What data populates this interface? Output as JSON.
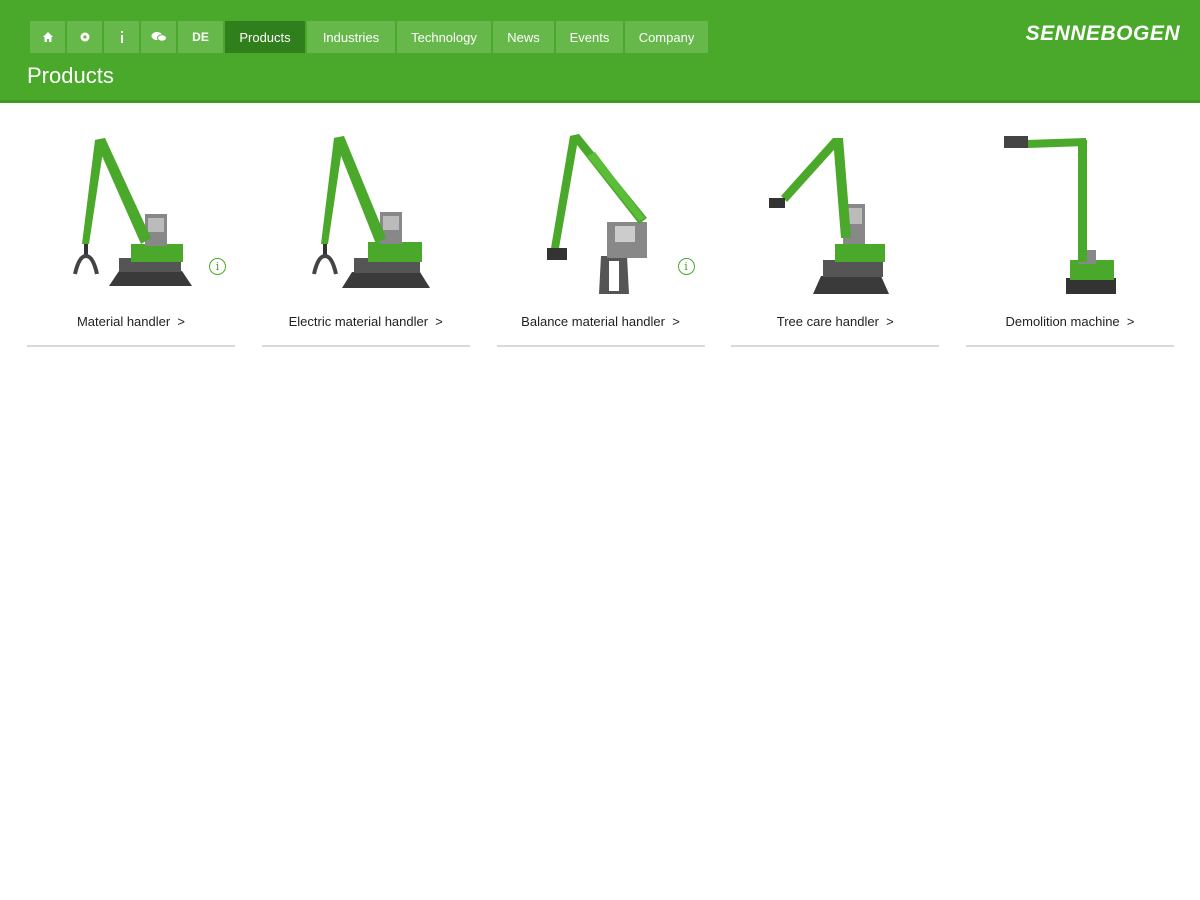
{
  "nav": {
    "icons": [
      {
        "name": "home-icon"
      },
      {
        "name": "settings-icon"
      },
      {
        "name": "info-icon"
      },
      {
        "name": "chat-icon"
      }
    ],
    "lang": "DE",
    "tabs": [
      "Products",
      "Industries",
      "Technology",
      "News",
      "Events",
      "Company"
    ],
    "active_tab": "Products"
  },
  "header": {
    "page_title": "Products",
    "logo_text": "SENNEBOGEN",
    "brand_color": "#4aa82a"
  },
  "products": [
    {
      "label": "Material handler",
      "chevron": ">",
      "info": true
    },
    {
      "label": "Electric material handler",
      "chevron": ">",
      "info": false
    },
    {
      "label": "Balance material handler",
      "chevron": ">",
      "info": true
    },
    {
      "label": "Tree care handler",
      "chevron": ">",
      "info": false
    },
    {
      "label": "Demolition machine",
      "chevron": ">",
      "info": false
    }
  ]
}
